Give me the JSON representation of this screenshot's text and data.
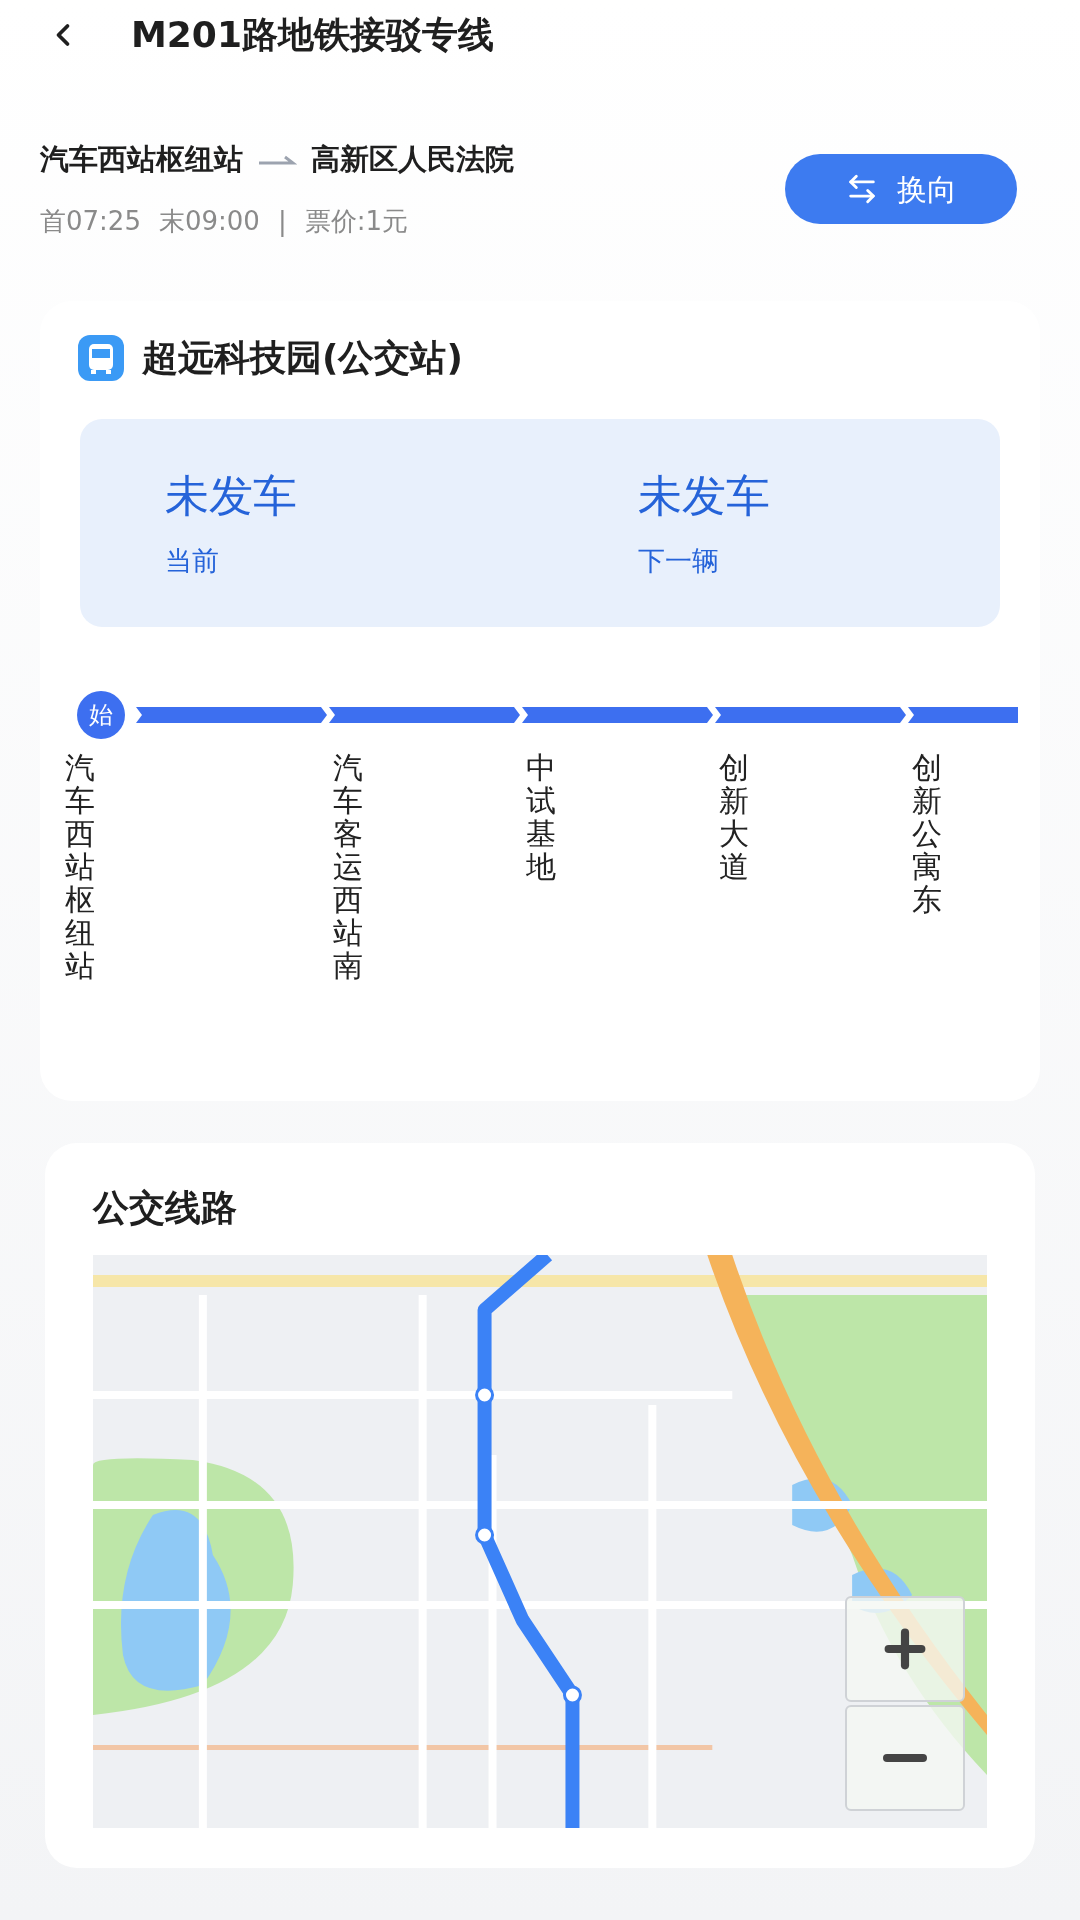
{
  "header": {
    "title": "M201路地铁接驳专线"
  },
  "route": {
    "from": "汽车西站枢纽站",
    "to": "高新区人民法院",
    "first": "首07:25",
    "last": "末09:00",
    "separator": "|",
    "fare": "票价:1元"
  },
  "reverse_button": {
    "label": "换向"
  },
  "stop_card": {
    "title": "超远科技园(公交站)",
    "arrivals": [
      {
        "status": "未发车",
        "label": "当前"
      },
      {
        "status": "未发车",
        "label": "下一辆"
      }
    ],
    "stations": [
      {
        "name": "汽车西站枢纽站",
        "badge": "始"
      },
      {
        "name": "汽车客运西站南"
      },
      {
        "name": "中试基地"
      },
      {
        "name": "创新大道"
      },
      {
        "name": "创新公寓东"
      }
    ]
  },
  "map_card": {
    "title": "公交线路"
  }
}
